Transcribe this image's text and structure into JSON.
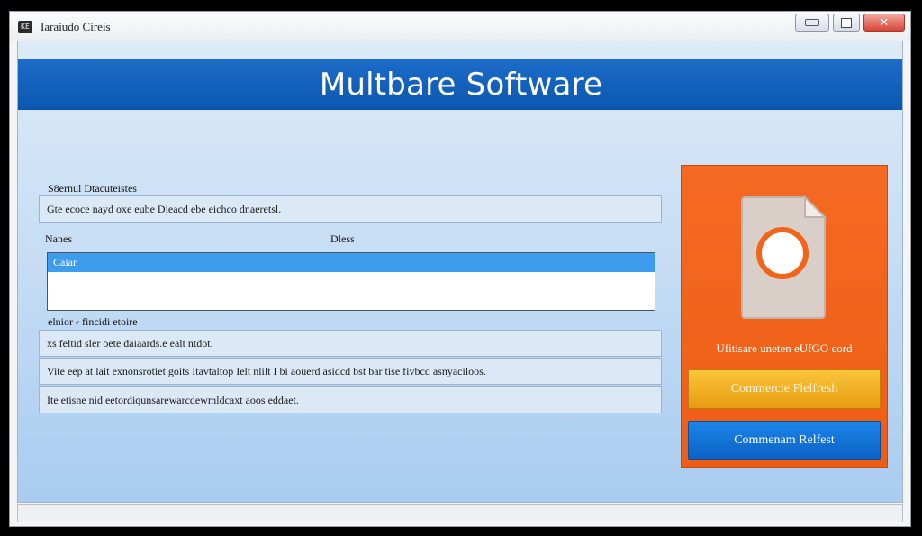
{
  "window": {
    "title": "Iaraiudo Cireis",
    "app_icon_text": "KE",
    "close_glyph": "✕"
  },
  "banner": {
    "title": "Multbare Software"
  },
  "form": {
    "section1_label": "S8ernul Dtacuteistes",
    "description_field": "Gte ecoce nayd oxe eube Dieacd ebe eichco dnaeretsl.",
    "col_names": "Nanes",
    "col_desc": "Dless",
    "list_selected": "Caiar",
    "section2_label": "elnior ⸗ fincidi etoire",
    "field_a": "xs feltid sler oete daiaards.e ealt ntdot.",
    "field_b": "Vite eep at lait exnonsrotiet goits Itavtaltop Ielt nlilt I bi aouerd asidcd bst bar tise fivbcd asnyaciloos.",
    "field_c": "Ite etisne nid eetordiqunsarewarcdewmldcaxt aoos eddaet."
  },
  "side_panel": {
    "promo_text": "Ufitisare uneten eUfGO cord",
    "primary_button": "Commercie Flelfresh",
    "secondary_button": "Commenam Relfest"
  },
  "colors": {
    "banner": "#0b5fbf",
    "side_panel": "#f26419",
    "button_yellow": "#f4b028",
    "button_blue": "#0f73d6",
    "list_selection": "#3c9cee"
  }
}
